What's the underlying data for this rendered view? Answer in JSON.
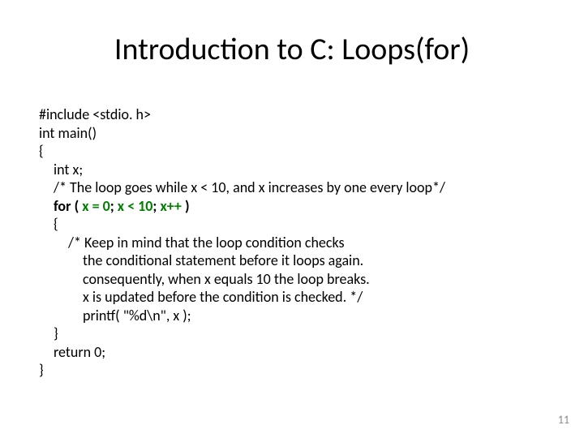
{
  "title": "Introduction to C: Loops(for)",
  "code": {
    "l1": "#include <stdio. h>",
    "l2": "int main()",
    "l3": "{",
    "l4": "int x;",
    "l5": "/* The loop goes while x < 10, and x increases by one every loop*/",
    "l6a": "for ( ",
    "l6b": "x = 0",
    "l6c": "; ",
    "l6d": "x < 10",
    "l6e": "; ",
    "l6f": "x++",
    "l6g": " )",
    "l7": "{",
    "l8": "/* Keep in mind that the loop condition checks",
    "l9": "the conditional statement before it loops again.",
    "l10": "consequently, when x equals 10 the loop breaks.",
    "l11": "x is updated before the condition is checked. */",
    "l12": "printf( \"%d\\n\", x );",
    "l13": "}",
    "l14": "return 0;",
    "l15": "}"
  },
  "pagenum": "11"
}
